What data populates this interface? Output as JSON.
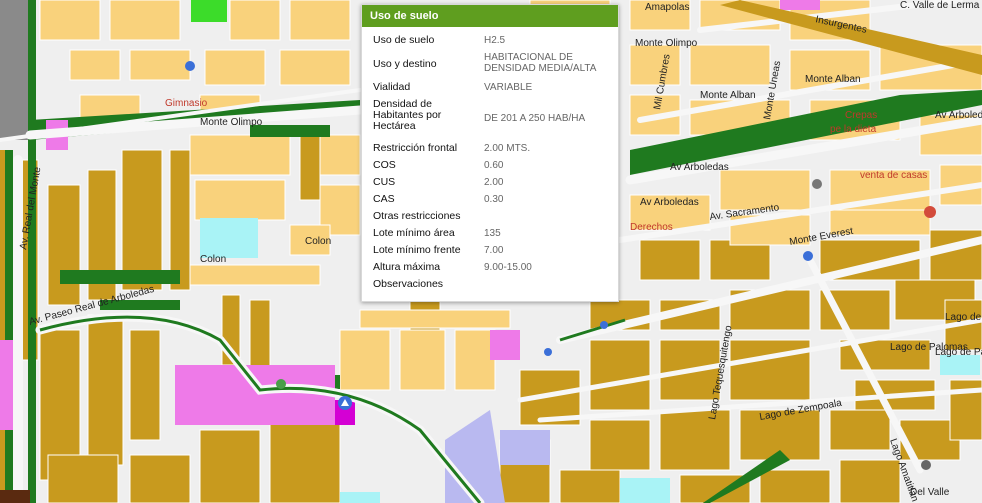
{
  "popup": {
    "title": "Uso de suelo",
    "rows": [
      {
        "label": "Uso de suelo",
        "value": "H2.5"
      },
      {
        "label": "Uso y destino",
        "value": "HABITACIONAL DE DENSIDAD MEDIA/ALTA"
      },
      {
        "label": "Vialidad",
        "value": "VARIABLE"
      },
      {
        "label": "Densidad de Habitantes por Hectárea",
        "value": "DE 201 A 250 HAB/HA"
      },
      {
        "label": "Restricción frontal",
        "value": "2.00 MTS."
      },
      {
        "label": "COS",
        "value": "0.60"
      },
      {
        "label": "CUS",
        "value": "2.00"
      },
      {
        "label": "CAS",
        "value": "0.30"
      },
      {
        "label": "Otras restricciones",
        "value": ""
      },
      {
        "label": "Lote mínimo área",
        "value": "135"
      },
      {
        "label": "Lote mínimo frente",
        "value": "7.00"
      },
      {
        "label": "Altura máxima",
        "value": "9.00-15.00"
      },
      {
        "label": "Observaciones",
        "value": ""
      }
    ]
  },
  "streets": {
    "s1": "Amapolas",
    "s2": "Monte Olimpo",
    "s3": "Monte Olimpo",
    "s4": "Monte Alban",
    "s5": "Monte Alban",
    "s6": "Av Arboledas",
    "s7": "Av Arboledas",
    "s8": "Av Arboledas",
    "s9": "Av. Real del Monte",
    "s10": "Av. Paseo Real de Arboledas",
    "s11": "Monte Everest",
    "s12": "Lago de Palomas",
    "s13": "Lago de Zempoala",
    "s14": "Colon",
    "s15": "Colon",
    "s16": "Insurgentes",
    "s17": "C. Valle de Lerma",
    "s18": "Mil Cumbres",
    "s19": "Monte Uneas",
    "s20": "Lago de",
    "s21": "Lago de Pa",
    "s22": "Lago Tequesquitengo",
    "s23": "Lago Amatitlan",
    "s24": "Del Valle",
    "s25": "Av. Sacramento"
  },
  "pois": {
    "p1": "Gimnasio",
    "p2": "Crepas",
    "p3": "pe la dieta",
    "p4": "venta de casas",
    "p5": "Derechos"
  },
  "colors": {
    "residential": "#f9d27c",
    "mixed": "#c89a1e",
    "green": "#1f7a1f",
    "commercial": "#ee7ae8",
    "equipment": "#b9b9f0",
    "water": "#a9f3f6",
    "header": "#5f9e1f",
    "street": "#f4f4f4"
  },
  "icons": {
    "marker": "map-pin-icon"
  }
}
